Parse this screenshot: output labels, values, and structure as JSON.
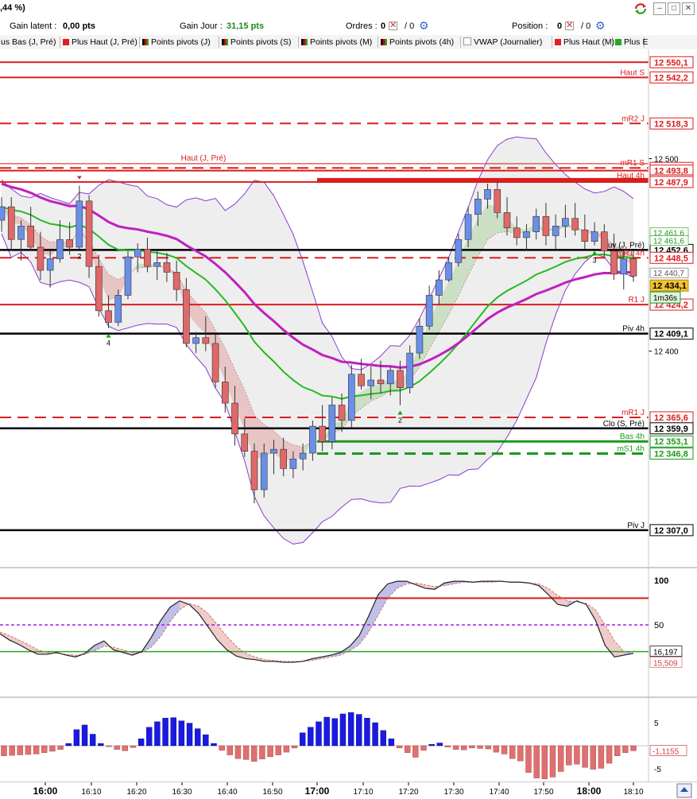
{
  "window": {
    "title": ",44 %)",
    "icon": "refresh-arrows-icon"
  },
  "status": {
    "gain_latent_label": "Gain latent :",
    "gain_latent_value": "0,00 pts",
    "gain_jour_label": "Gain Jour :",
    "gain_jour_value": "31,15 pts",
    "ordres_label": "Ordres :",
    "ordres_value": "0",
    "ordres_sep": "/ 0",
    "position_label": "Position :",
    "position_value": "0",
    "position_sep": "/ 0"
  },
  "legend": [
    {
      "label": "us Bas (J, Pré)",
      "swatch": "none"
    },
    {
      "label": "Plus Haut (J, Pré)",
      "swatch": "#e02020"
    },
    {
      "label": "Points pivots (J)",
      "swatch": "multi"
    },
    {
      "label": "Points pivots (S)",
      "swatch": "multi"
    },
    {
      "label": "Points pivots (M)",
      "swatch": "multi"
    },
    {
      "label": "Points pivots (4h)",
      "swatch": "multi"
    },
    {
      "label": "VWAP (Journalier)",
      "swatch": "#ffffff"
    },
    {
      "label": "Plus Haut (M)",
      "swatch": "#e02020"
    },
    {
      "label": "Plus E",
      "swatch": "#22aa22"
    }
  ],
  "colors": {
    "up_candle": "#6a8fe8",
    "down_candle": "#e06868",
    "red_level": "#d81e1e",
    "black_level": "#000000",
    "green_level": "#1a9a1a",
    "vwap": "#c020c0",
    "ema": "#22bb22",
    "bollinger": "#8a3ccc",
    "price_tag": "#f2c230"
  },
  "price_scale": {
    "min": 12290,
    "max": 12556,
    "ticks": [
      "12 500",
      "12 400"
    ]
  },
  "levels": [
    {
      "price": 12550.1,
      "value": "12 550,1",
      "label": "",
      "color": "red",
      "style": "solid",
      "bold": true
    },
    {
      "price": 12542.2,
      "value": "12 542,2",
      "label": "Haut S",
      "color": "red",
      "style": "solid",
      "bold": true
    },
    {
      "price": 12518.3,
      "value": "12 518,3",
      "label": "mR2 J",
      "color": "red",
      "style": "dash",
      "bold": true
    },
    {
      "price": 12495.2,
      "value": "12 495,2",
      "label": "mR1 S",
      "color": "red",
      "style": "dash",
      "bold": true
    },
    {
      "price": 12493.8,
      "value": "12 493,8",
      "label": "",
      "color": "red",
      "style": "solid",
      "bold": true
    },
    {
      "price": 12488.7,
      "value": "12 488,7",
      "label": "Haut 4h",
      "color": "red",
      "style": "solid",
      "bold": true
    },
    {
      "price": 12487.9,
      "value": "12 487,9",
      "label": "",
      "color": "red",
      "style": "solid",
      "bold": true
    },
    {
      "price": 12452.6,
      "value": "12 452,6",
      "label": "Ouv (J, Pré)",
      "color": "black",
      "style": "solid",
      "bold": true
    },
    {
      "price": 12448.5,
      "value": "12 448,5",
      "label": "mR1 4h",
      "color": "red",
      "style": "dash",
      "bold": true
    },
    {
      "price": 12424.2,
      "value": "12 424,2",
      "label": "R1 J",
      "color": "red",
      "style": "solid",
      "bold": true
    },
    {
      "price": 12409.1,
      "value": "12 409,1",
      "label": "Piv 4h",
      "color": "black",
      "style": "solid",
      "bold": true
    },
    {
      "price": 12365.6,
      "value": "12 365,6",
      "label": "mR1 J",
      "color": "red",
      "style": "dash",
      "bold": true
    },
    {
      "price": 12359.9,
      "value": "12 359,9",
      "label": "Clo (S, Pré)",
      "color": "black",
      "style": "solid",
      "bold": true
    },
    {
      "price": 12353.1,
      "value": "12 353,1",
      "label": "Bas 4h",
      "color": "green",
      "style": "solid",
      "bold": true
    },
    {
      "price": 12346.8,
      "value": "12 346,8",
      "label": "mS1 4h",
      "color": "green",
      "style": "dash",
      "bold": true
    },
    {
      "price": 12307.0,
      "value": "12 307,0",
      "label": "Piv J",
      "color": "black",
      "style": "solid",
      "bold": true
    }
  ],
  "haut_jpre_label": "Haut (J, Pré)",
  "small_values": [
    {
      "price": 12461.6,
      "value": "12 461,6"
    },
    {
      "price": 12457.5,
      "value": "12 461,6"
    },
    {
      "price": 12440.7,
      "value": "12 440,7"
    }
  ],
  "current_price": {
    "price": 12434.1,
    "value": "12 434,1",
    "countdown": "1m36s"
  },
  "candles": [
    [
      12468,
      12480,
      12462,
      12475
    ],
    [
      12475,
      12480,
      12452,
      12458
    ],
    [
      12458,
      12468,
      12447,
      12465
    ],
    [
      12465,
      12475,
      12452,
      12454
    ],
    [
      12454,
      12462,
      12437,
      12442
    ],
    [
      12442,
      12452,
      12433,
      12448
    ],
    [
      12448,
      12468,
      12446,
      12458
    ],
    [
      12458,
      12467,
      12450,
      12454
    ],
    [
      12454,
      12486,
      12453,
      12478
    ],
    [
      12478,
      12481,
      12438,
      12444
    ],
    [
      12444,
      12450,
      12418,
      12421
    ],
    [
      12421,
      12429,
      12412,
      12415
    ],
    [
      12415,
      12432,
      12413,
      12429
    ],
    [
      12429,
      12452,
      12427,
      12449
    ],
    [
      12449,
      12456,
      12441,
      12453
    ],
    [
      12453,
      12459,
      12441,
      12444
    ],
    [
      12444,
      12452,
      12437,
      12446
    ],
    [
      12446,
      12451,
      12436,
      12441
    ],
    [
      12441,
      12447,
      12426,
      12432
    ],
    [
      12432,
      12438,
      12402,
      12404
    ],
    [
      12404,
      12410,
      12399,
      12407
    ],
    [
      12407,
      12418,
      12400,
      12404
    ],
    [
      12404,
      12409,
      12381,
      12384
    ],
    [
      12384,
      12392,
      12368,
      12373
    ],
    [
      12373,
      12382,
      12351,
      12357
    ],
    [
      12357,
      12365,
      12345,
      12348
    ],
    [
      12348,
      12352,
      12321,
      12328
    ],
    [
      12328,
      12352,
      12324,
      12347
    ],
    [
      12347,
      12354,
      12336,
      12349
    ],
    [
      12349,
      12355,
      12335,
      12339
    ],
    [
      12339,
      12348,
      12334,
      12344
    ],
    [
      12344,
      12352,
      12338,
      12347
    ],
    [
      12347,
      12364,
      12343,
      12361
    ],
    [
      12361,
      12372,
      12348,
      12353
    ],
    [
      12353,
      12376,
      12349,
      12372
    ],
    [
      12372,
      12378,
      12358,
      12364
    ],
    [
      12364,
      12393,
      12360,
      12388
    ],
    [
      12388,
      12396,
      12380,
      12382
    ],
    [
      12382,
      12392,
      12375,
      12385
    ],
    [
      12385,
      12395,
      12378,
      12383
    ],
    [
      12383,
      12392,
      12377,
      12390
    ],
    [
      12390,
      12395,
      12372,
      12381
    ],
    [
      12381,
      12403,
      12378,
      12399
    ],
    [
      12399,
      12417,
      12396,
      12413
    ],
    [
      12413,
      12434,
      12411,
      12429
    ],
    [
      12429,
      12442,
      12424,
      12437
    ],
    [
      12437,
      12449,
      12436,
      12446
    ],
    [
      12446,
      12461,
      12444,
      12458
    ],
    [
      12458,
      12475,
      12454,
      12471
    ],
    [
      12471,
      12483,
      12465,
      12479
    ],
    [
      12479,
      12487,
      12474,
      12484
    ],
    [
      12484,
      12488,
      12469,
      12472
    ],
    [
      12472,
      12480,
      12460,
      12464
    ],
    [
      12464,
      12470,
      12455,
      12459
    ],
    [
      12459,
      12466,
      12452,
      12462
    ],
    [
      12462,
      12474,
      12458,
      12470
    ],
    [
      12470,
      12477,
      12455,
      12460
    ],
    [
      12460,
      12471,
      12453,
      12465
    ],
    [
      12465,
      12476,
      12459,
      12469
    ],
    [
      12469,
      12477,
      12460,
      12463
    ],
    [
      12463,
      12471,
      12453,
      12457
    ],
    [
      12457,
      12467,
      12455,
      12462
    ],
    [
      12462,
      12466,
      12449,
      12452
    ],
    [
      12452,
      12461,
      12437,
      12440
    ],
    [
      12440,
      12452,
      12432,
      12448
    ],
    [
      12448,
      12452,
      12436,
      12439
    ]
  ],
  "signals": [
    {
      "idx": 8,
      "type": "down",
      "label": "2"
    },
    {
      "idx": 11,
      "type": "up",
      "label": "4"
    },
    {
      "idx": 41,
      "type": "up",
      "label": "2"
    },
    {
      "idx": 61,
      "type": "up",
      "label": "3"
    }
  ],
  "stoch": {
    "ticks": [
      "100",
      "50"
    ],
    "value1": "16,197",
    "value2": "15,509",
    "k": [
      40,
      33,
      28,
      22,
      17,
      17,
      19,
      16,
      14,
      18,
      27,
      32,
      22,
      19,
      16,
      20,
      36,
      55,
      70,
      77,
      73,
      63,
      48,
      33,
      22,
      15,
      12,
      11,
      9,
      9,
      8,
      8,
      9,
      12,
      14,
      16,
      19,
      26,
      38,
      60,
      84,
      96,
      99,
      99,
      95,
      91,
      90,
      97,
      99,
      99,
      98,
      99,
      99,
      99,
      98,
      98,
      97,
      94,
      84,
      73,
      71,
      77,
      73,
      55,
      27,
      14,
      16,
      18
    ],
    "d": [
      42,
      38,
      33,
      28,
      22,
      19,
      18,
      17,
      16,
      17,
      21,
      26,
      25,
      22,
      19,
      19,
      25,
      37,
      54,
      67,
      74,
      71,
      63,
      50,
      37,
      26,
      18,
      14,
      11,
      10,
      9,
      9,
      9,
      10,
      12,
      14,
      16,
      21,
      28,
      42,
      61,
      80,
      91,
      96,
      97,
      95,
      93,
      94,
      96,
      98,
      98,
      98,
      98,
      99,
      98,
      98,
      97,
      96,
      91,
      83,
      77,
      76,
      74,
      67,
      50,
      32,
      20,
      18
    ]
  },
  "histo": {
    "ticks": [
      "5",
      "-5"
    ],
    "value": "-1,1155",
    "values": [
      -2.2,
      -2.1,
      -2.0,
      -1.9,
      -1.8,
      -1.5,
      -1.2,
      -0.8,
      0.5,
      3.5,
      4.5,
      2.5,
      0.5,
      -0.2,
      -0.8,
      -1.1,
      -0.4,
      1.5,
      4.0,
      5.2,
      6.0,
      6.1,
      5.4,
      4.9,
      3.7,
      2.4,
      0.5,
      -1.0,
      -2.0,
      -2.8,
      -3.0,
      -3.4,
      -2.9,
      -2.4,
      -2.0,
      -1.4,
      -0.5,
      2.8,
      4.0,
      5.2,
      6.2,
      5.9,
      6.9,
      7.2,
      6.8,
      6.0,
      5.0,
      3.3,
      1.5,
      -0.5,
      -1.5,
      -2.5,
      -1.0,
      0.3,
      0.6,
      -0.3,
      -0.8,
      -0.9,
      -0.5,
      -0.6,
      -0.7,
      -1.4,
      -1.8,
      -2.8,
      -3.3,
      -5.8,
      -7.0,
      -7.2,
      -6.8,
      -5.6,
      -4.2,
      -4.0,
      -4.7,
      -5.1,
      -4.9,
      -3.8,
      -2.2,
      -1.5,
      -1.1
    ]
  },
  "time_axis": [
    {
      "label": "16:00",
      "bold": true
    },
    {
      "label": "16:10",
      "bold": false
    },
    {
      "label": "16:20",
      "bold": false
    },
    {
      "label": "16:30",
      "bold": false
    },
    {
      "label": "16:40",
      "bold": false
    },
    {
      "label": "16:50",
      "bold": false
    },
    {
      "label": "17:00",
      "bold": true
    },
    {
      "label": "17:10",
      "bold": false
    },
    {
      "label": "17:20",
      "bold": false
    },
    {
      "label": "17:30",
      "bold": false
    },
    {
      "label": "17:40",
      "bold": false
    },
    {
      "label": "17:50",
      "bold": false
    },
    {
      "label": "18:00",
      "bold": true
    },
    {
      "label": "18:10",
      "bold": false
    }
  ],
  "scroll_icon": "scroll-up-icon"
}
